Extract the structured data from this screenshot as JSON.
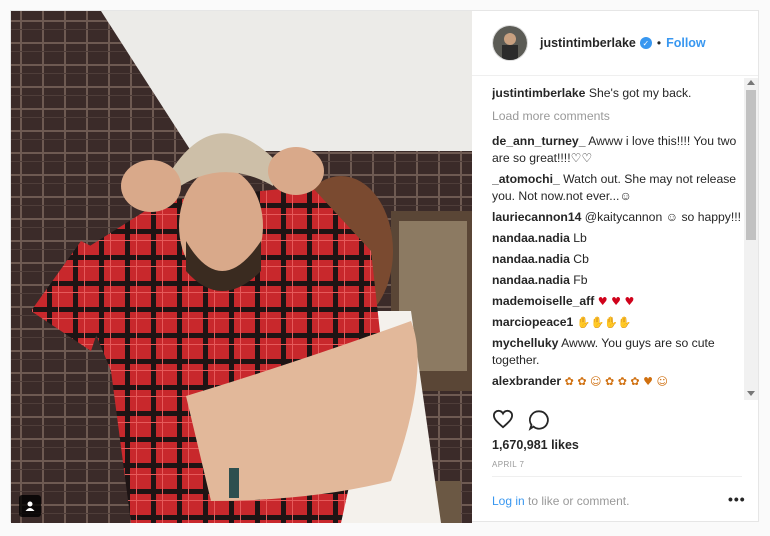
{
  "post": {
    "username": "justintimberlake",
    "separator": "•",
    "follow_label": "Follow",
    "likes": "1,670,981 likes",
    "date": "APRIL 7",
    "login_link": "Log in",
    "login_suffix": " to like or comment.",
    "more_label": "•••"
  },
  "caption": {
    "user": "justintimberlake",
    "text": " She's got my back."
  },
  "load_more": "Load more comments",
  "comments": [
    {
      "user": "de_ann_turney_",
      "text": " Awww i love this!!!! You two are so great!!!!♡♡"
    },
    {
      "user": "_atomochi_",
      "text": " Watch out. She may not release you. Not now.not ever...☺"
    },
    {
      "user": "lauriecannon14",
      "text": " @kaitycannon ☺ so happy!!!"
    },
    {
      "user": "nandaa.nadia",
      "text": " Lb"
    },
    {
      "user": "nandaa.nadia",
      "text": " Cb"
    },
    {
      "user": "nandaa.nadia",
      "text": " Fb"
    },
    {
      "user": "mademoiselle_aff",
      "text": " ♥ ♥ ♥"
    },
    {
      "user": "marciopeace1",
      "text": " ✋✋✋✋"
    },
    {
      "user": "mychelluky",
      "text": " Awww. You guys are so cute together."
    },
    {
      "user": "alexbrander",
      "text": " ✿ ✿ ☺ ✿ ✿ ✿ ♥ ☺"
    }
  ],
  "colors": {
    "accent": "#3897f0",
    "muted": "#999999",
    "text": "#262626"
  },
  "icons": {
    "like": "heart-icon",
    "comment": "comment-icon",
    "user_tag": "person-icon",
    "verified": "verified-badge-icon"
  }
}
